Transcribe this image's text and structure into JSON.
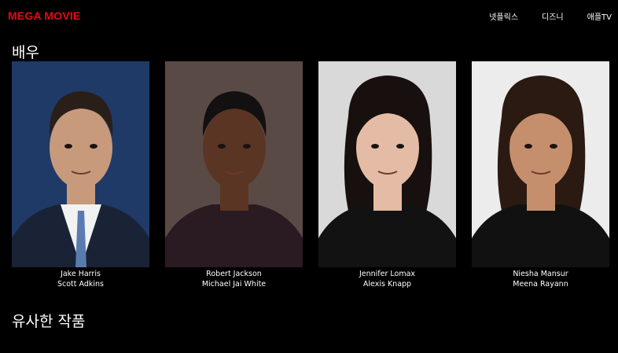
{
  "header": {
    "logo": "MEGA MOVIE",
    "nav": [
      {
        "label": "넷플릭스"
      },
      {
        "label": "디즈니"
      },
      {
        "label": "애플TV"
      }
    ]
  },
  "sections": {
    "cast_title": "배우",
    "similar_title": "유사한 작품"
  },
  "cast": [
    {
      "role": "Jake Harris",
      "actor": "Scott Adkins",
      "bg": "#1f3a66",
      "skin": "#c89a7c",
      "hair": "#2a1e18",
      "cloth": "#1a2236"
    },
    {
      "role": "Robert Jackson",
      "actor": "Michael Jai White",
      "bg": "#5a4a46",
      "skin": "#5a3524",
      "hair": "#121010",
      "cloth": "#2a1a22"
    },
    {
      "role": "Jennifer Lomax",
      "actor": "Alexis Knapp",
      "bg": "#d9d9d9",
      "skin": "#e4bba4",
      "hair": "#17100e",
      "cloth": "#121212"
    },
    {
      "role": "Niesha Mansur",
      "actor": "Meena Rayann",
      "bg": "#ececec",
      "skin": "#c58f6d",
      "hair": "#2a1a12",
      "cloth": "#111111"
    }
  ]
}
